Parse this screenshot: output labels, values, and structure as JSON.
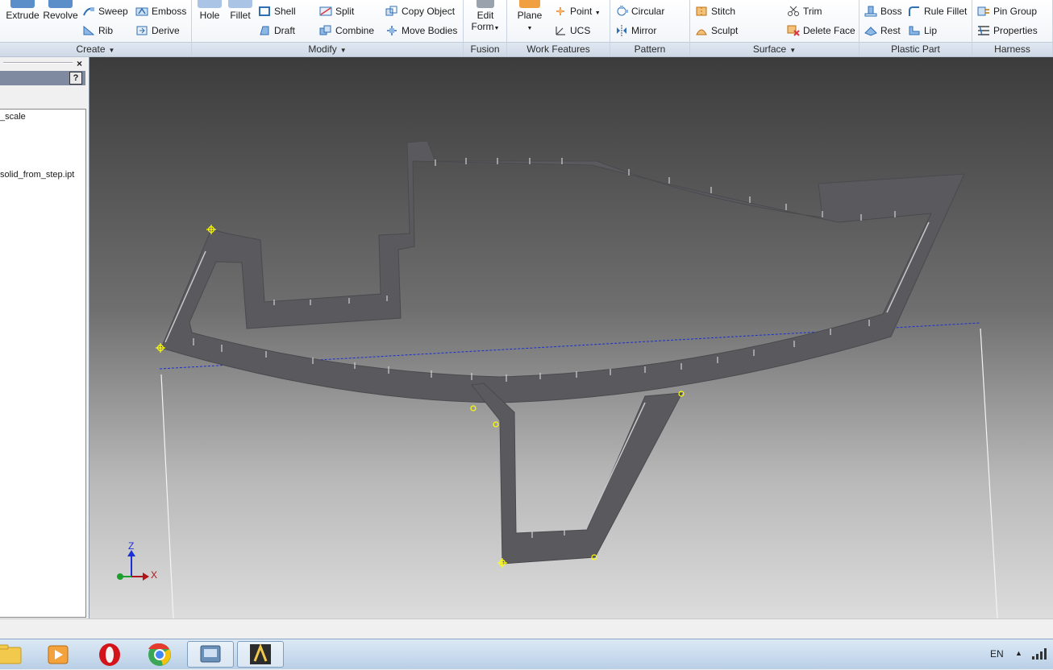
{
  "ribbon": {
    "create": {
      "label": "Create",
      "extrude": "Extrude",
      "revolve": "Revolve",
      "sweep": "Sweep",
      "emboss": "Emboss",
      "rib": "Rib",
      "derive": "Derive"
    },
    "modify": {
      "label": "Modify",
      "hole": "Hole",
      "fillet": "Fillet",
      "shell": "Shell",
      "draft": "Draft",
      "split": "Split",
      "combine": "Combine",
      "copy_object": "Copy Object",
      "move_bodies": "Move Bodies"
    },
    "fusion": {
      "label": "Fusion",
      "edit": "Edit",
      "form": "Form"
    },
    "work_features": {
      "label": "Work Features",
      "plane": "Plane",
      "point": "Point",
      "ucs": "UCS"
    },
    "pattern": {
      "label": "Pattern",
      "circular": "Circular",
      "mirror": "Mirror"
    },
    "surface": {
      "label": "Surface",
      "stitch": "Stitch",
      "sculpt": "Sculpt",
      "trim": "Trim",
      "delete_face": "Delete Face"
    },
    "plastic_part": {
      "label": "Plastic Part",
      "boss": "Boss",
      "rest": "Rest",
      "rule_fillet": "Rule Fillet",
      "lip": "Lip"
    },
    "harness": {
      "label": "Harness",
      "pin_group": "Pin Group",
      "properties": "Properties"
    }
  },
  "browser": {
    "help": "?",
    "close": "×",
    "items": [
      "_scale",
      "solid_from_step.ipt"
    ]
  },
  "viewcube": {
    "z": "Z",
    "x": "X"
  },
  "taskbar": {
    "language": "EN"
  },
  "colors": {
    "ribbon_bg": "#eef2f7",
    "panel_head": "#7f8aa0",
    "model": "#5a5a5e",
    "sketch_line": "#1a2fd4",
    "point": "#ffff00"
  }
}
